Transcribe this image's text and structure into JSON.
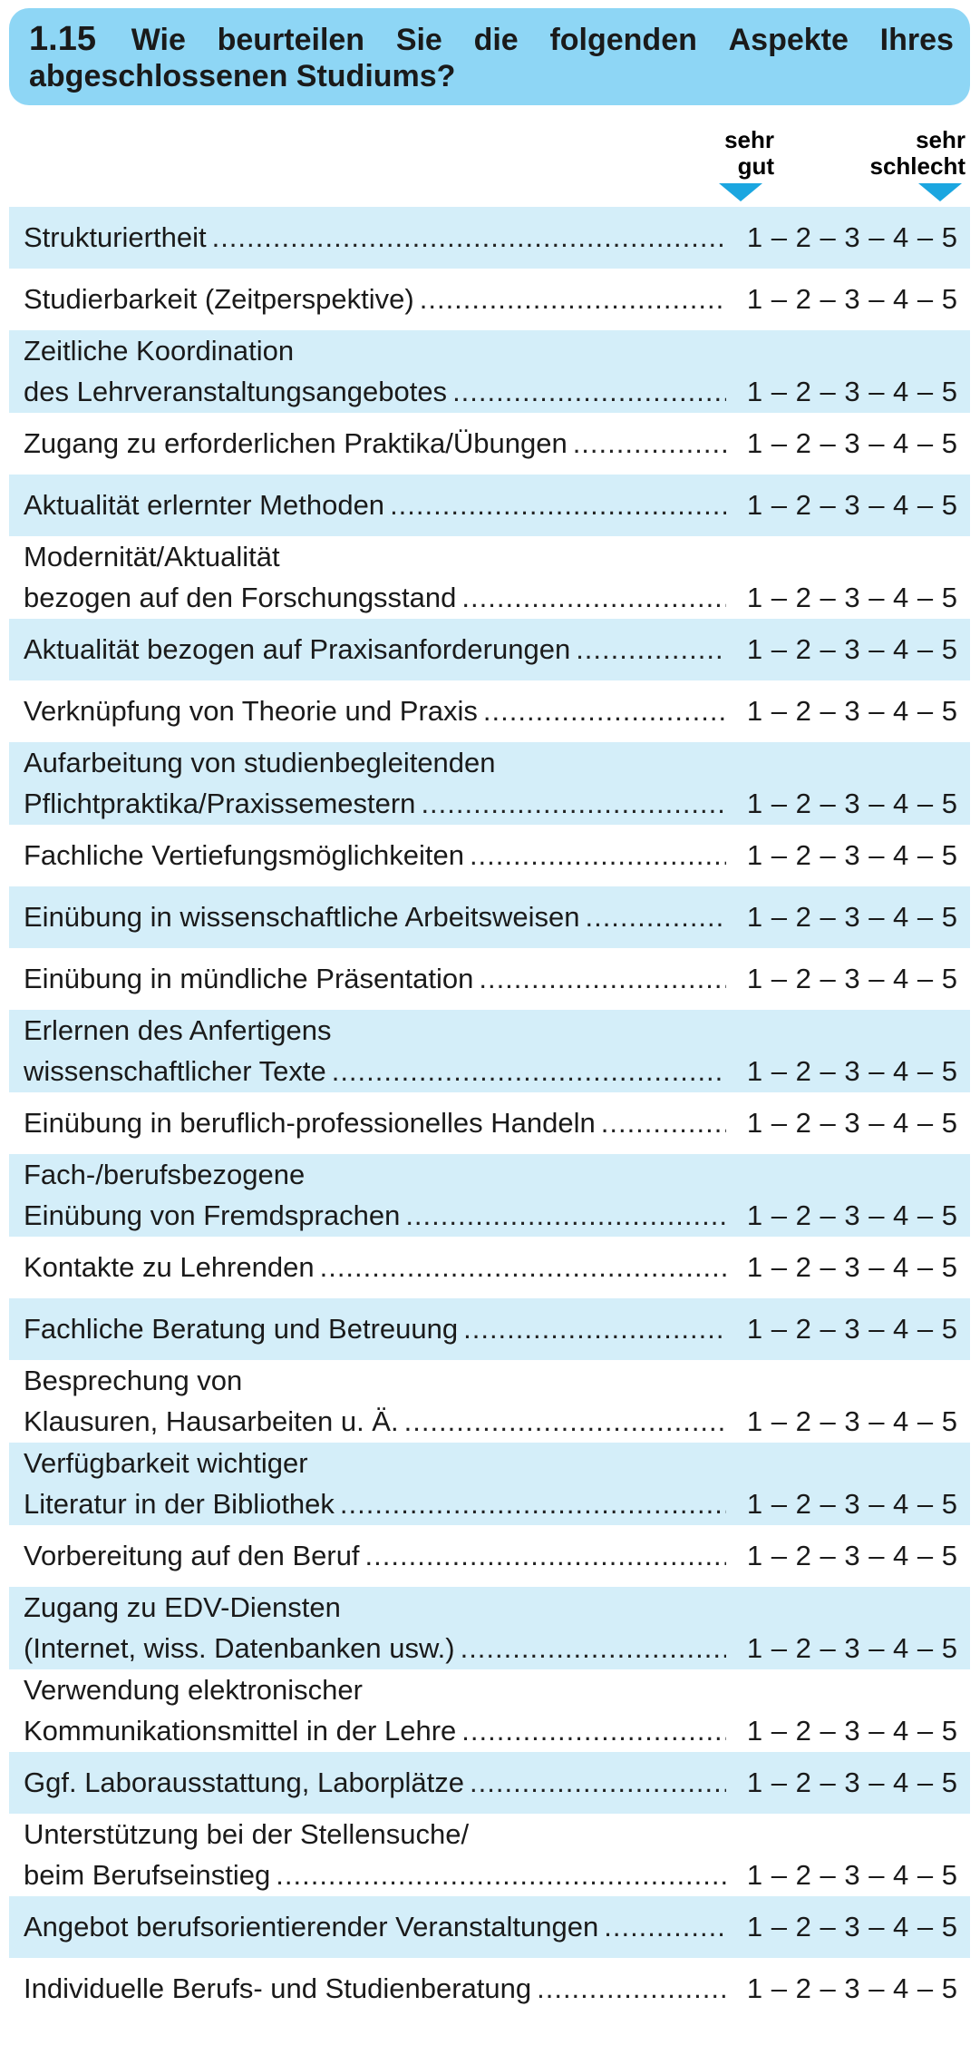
{
  "question": {
    "number": "1.15",
    "line1_words": [
      "Wie",
      "beurteilen",
      "Sie",
      "die",
      "folgenden",
      "Aspekte",
      "Ihres"
    ],
    "line2": "abgeschlossenen Studiums?"
  },
  "scale_labels": {
    "best": "sehr gut",
    "worst": "sehr schlecht"
  },
  "scale_text": "1 – 2 – 3 – 4 – 5",
  "items": [
    {
      "lines": [
        "Strukturiertheit"
      ]
    },
    {
      "lines": [
        "Studierbarkeit (Zeitperspektive)"
      ]
    },
    {
      "lines": [
        "Zeitliche Koordination",
        "des Lehrveranstaltungsangebotes"
      ]
    },
    {
      "lines": [
        "Zugang zu erforderlichen Praktika/Übungen"
      ]
    },
    {
      "lines": [
        "Aktualität erlernter Methoden"
      ]
    },
    {
      "lines": [
        "Modernität/Aktualität",
        "bezogen auf den Forschungsstand"
      ]
    },
    {
      "lines": [
        "Aktualität bezogen auf Praxisanforderungen"
      ]
    },
    {
      "lines": [
        "Verknüpfung von Theorie und Praxis"
      ]
    },
    {
      "lines": [
        "Aufarbeitung von studienbegleitenden",
        "Pflichtpraktika/Praxissemestern"
      ]
    },
    {
      "lines": [
        "Fachliche Vertiefungsmöglichkeiten"
      ]
    },
    {
      "lines": [
        "Einübung in wissenschaftliche Arbeitsweisen"
      ]
    },
    {
      "lines": [
        "Einübung in mündliche Präsentation"
      ]
    },
    {
      "lines": [
        "Erlernen des Anfertigens",
        "wissenschaftlicher Texte"
      ]
    },
    {
      "lines": [
        "Einübung in beruflich-professionelles Handeln"
      ]
    },
    {
      "lines": [
        "Fach-/berufsbezogene",
        "Einübung von Fremdsprachen"
      ]
    },
    {
      "lines": [
        "Kontakte zu Lehrenden"
      ]
    },
    {
      "lines": [
        "Fachliche Beratung und Betreuung"
      ]
    },
    {
      "lines": [
        "Besprechung von",
        "Klausuren, Hausarbeiten u. Ä."
      ]
    },
    {
      "lines": [
        "Verfügbarkeit wichtiger",
        "Literatur in der Bibliothek"
      ]
    },
    {
      "lines": [
        "Vorbereitung auf den Beruf"
      ]
    },
    {
      "lines": [
        "Zugang zu EDV-Diensten",
        "(Internet, wiss. Datenbanken usw.)"
      ]
    },
    {
      "lines": [
        "Verwendung elektronischer",
        "Kommunikationsmittel in der Lehre"
      ]
    },
    {
      "lines": [
        "Ggf. Laborausstattung, Laborplätze"
      ]
    },
    {
      "lines": [
        "Unterstützung bei der Stellensuche/",
        "beim Berufseinstieg"
      ]
    },
    {
      "lines": [
        "Angebot berufsorientierender Veranstaltungen"
      ]
    },
    {
      "lines": [
        "Individuelle Berufs- und Studienberatung"
      ]
    }
  ],
  "colors": {
    "header_bg": "#8ed6f5",
    "row_shade": "#d4eef9",
    "arrow": "#1ba6e0"
  }
}
